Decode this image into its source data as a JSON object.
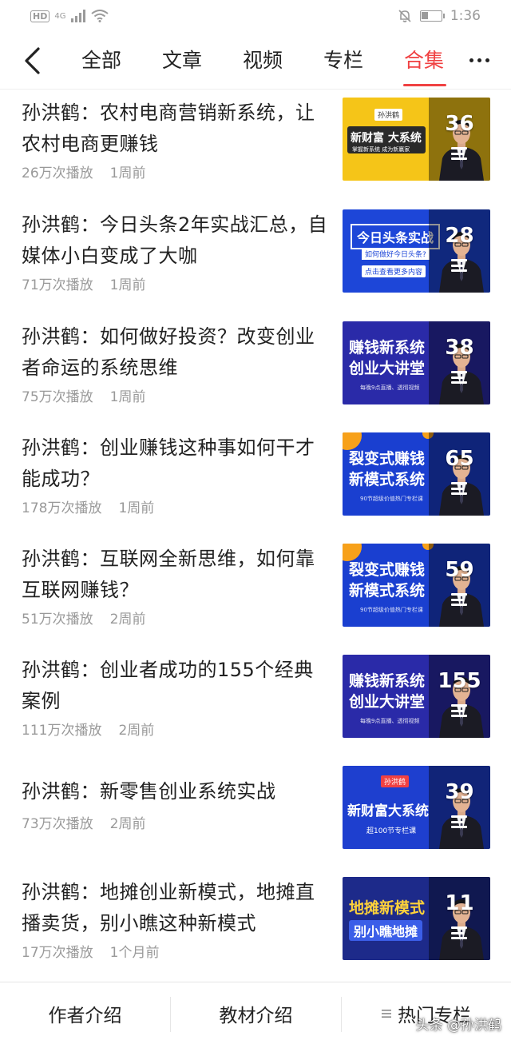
{
  "status_bar": {
    "network": "HD",
    "signal": "4G",
    "time": "1:36",
    "battery_level": 0.35
  },
  "nav": {
    "tabs": [
      {
        "label": "全部"
      },
      {
        "label": "文章"
      },
      {
        "label": "视频"
      },
      {
        "label": "专栏"
      },
      {
        "label": "合集"
      }
    ],
    "active_tab": "合集"
  },
  "items": [
    {
      "title": "孙洪鹤：农村电商营销新系统，让农村电商更赚钱",
      "plays": "26万次播放",
      "time": "1周前",
      "count": "36",
      "thumb": {
        "bg": "#f5c518",
        "headline": "新财富 大系统",
        "sub": "掌握新系统 成为新赢家",
        "tag": "孙洪鹤",
        "style": "yellow"
      }
    },
    {
      "title": "孙洪鹤：今日头条2年实战汇总，自媒体小白变成了大咖",
      "plays": "71万次播放",
      "time": "1周前",
      "count": "28",
      "thumb": {
        "bg": "#1d46d8",
        "headline": "今日头条实战",
        "sub": "如何做好今日头条?",
        "tag": "点击查看更多内容",
        "style": "blue-box"
      }
    },
    {
      "title": "孙洪鹤：如何做好投资？改变创业者命运的系统思维",
      "plays": "75万次播放",
      "time": "1周前",
      "count": "38",
      "thumb": {
        "bg": "#2a2aa8",
        "headline": "赚钱新系统",
        "headline2": "创业大讲堂",
        "sub": "每晚9点直播、透彻视频",
        "style": "two-line"
      }
    },
    {
      "title": "孙洪鹤：创业赚钱这种事如何干才能成功？",
      "plays": "178万次播放",
      "time": "1周前",
      "count": "65",
      "thumb": {
        "bg": "#1a3fd0",
        "headline": "裂变式赚钱",
        "headline2": "新模式系统",
        "sub": "90节超级价值热门专栏课",
        "style": "two-line-orange"
      }
    },
    {
      "title": "孙洪鹤：互联网全新思维，如何靠互联网赚钱？",
      "plays": "51万次播放",
      "time": "2周前",
      "count": "59",
      "thumb": {
        "bg": "#1a3fd0",
        "headline": "裂变式赚钱",
        "headline2": "新模式系统",
        "sub": "90节超级价值热门专栏课",
        "style": "two-line-orange"
      }
    },
    {
      "title": "孙洪鹤：创业者成功的155个经典案例",
      "plays": "111万次播放",
      "time": "2周前",
      "count": "155",
      "thumb": {
        "bg": "#2a2aa8",
        "headline": "赚钱新系统",
        "headline2": "创业大讲堂",
        "sub": "每晚9点直播、透彻视频",
        "style": "two-line"
      }
    },
    {
      "title": "孙洪鹤：新零售创业系统实战",
      "plays": "73万次播放",
      "time": "2周前",
      "count": "39",
      "thumb": {
        "bg": "#1e3fcf",
        "headline": "新财富大系统",
        "sub": "超100节专栏课",
        "tag": "孙洪鹤",
        "style": "blue-tag"
      }
    },
    {
      "title": "孙洪鹤：地摊创业新模式，地摊直播卖货，别小瞧这种新模式",
      "plays": "17万次播放",
      "time": "1个月前",
      "count": "11",
      "thumb": {
        "bg": "#1d2a8a",
        "headline": "地摊新模式",
        "headline2": "别小瞧地摊",
        "style": "yellow-text"
      }
    }
  ],
  "bottom_bar": {
    "items": [
      {
        "label": "作者介绍"
      },
      {
        "label": "教材介绍"
      },
      {
        "label": "热门专栏"
      }
    ],
    "watermark": "头条 @孙洪鹤"
  },
  "colors": {
    "accent": "#f04142",
    "meta_text": "#999999"
  }
}
